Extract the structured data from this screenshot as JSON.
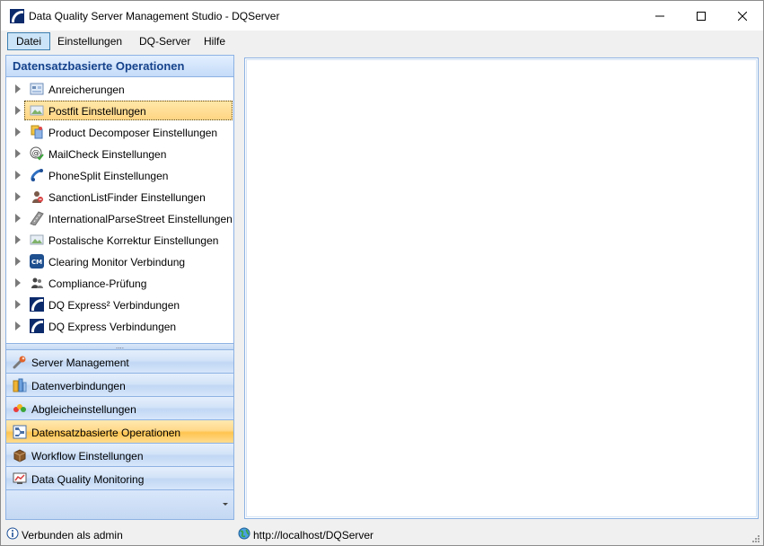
{
  "window": {
    "title": "Data Quality Server Management Studio - DQServer",
    "app_icon": "dq-logo-icon",
    "controls": [
      "minimize-icon",
      "maximize-icon",
      "close-icon"
    ]
  },
  "menubar": {
    "items": [
      {
        "label": "Datei",
        "active": true
      },
      {
        "label": "Einstellungen"
      },
      {
        "label": "DQ-Server"
      },
      {
        "label": "Hilfe"
      }
    ]
  },
  "left_pane": {
    "header": "Datensatzbasierte Operationen",
    "tree_items": [
      {
        "label": "Anreicherungen",
        "icon": "enrichment-icon"
      },
      {
        "label": "Postfit Einstellungen",
        "icon": "postfit-icon",
        "selected": true
      },
      {
        "label": "Product Decomposer Einstellungen",
        "icon": "product-decomposer-icon"
      },
      {
        "label": "MailCheck Einstellungen",
        "icon": "mailcheck-icon"
      },
      {
        "label": "PhoneSplit Einstellungen",
        "icon": "phonesplit-icon"
      },
      {
        "label": "SanctionListFinder Einstellungen",
        "icon": "sanction-list-icon"
      },
      {
        "label": "InternationalParseStreet Einstellungen",
        "icon": "parse-street-icon"
      },
      {
        "label": "Postalische Korrektur Einstellungen",
        "icon": "postal-correction-icon"
      },
      {
        "label": "Clearing Monitor Verbindung",
        "icon": "clearing-monitor-icon"
      },
      {
        "label": "Compliance-Prüfung",
        "icon": "compliance-icon"
      },
      {
        "label": "DQ Express² Verbindungen",
        "icon": "dq-express2-icon"
      },
      {
        "label": "DQ Express Verbindungen",
        "icon": "dq-express-icon"
      }
    ],
    "splitter_grip": "....",
    "nav_buttons": [
      {
        "label": "Server Management",
        "icon": "wrench-icon"
      },
      {
        "label": "Datenverbindungen",
        "icon": "data-connection-icon"
      },
      {
        "label": "Abgleicheinstellungen",
        "icon": "matching-icon"
      },
      {
        "label": "Datensatzbasierte Operationen",
        "icon": "record-operations-icon",
        "active": true
      },
      {
        "label": "Workflow Einstellungen",
        "icon": "workflow-icon"
      },
      {
        "label": "Data Quality Monitoring",
        "icon": "monitoring-icon"
      }
    ]
  },
  "statusbar": {
    "left_text": "Verbunden als admin",
    "left_icon": "info-icon",
    "right_text": "http://localhost/DQServer",
    "right_icon": "globe-icon"
  }
}
